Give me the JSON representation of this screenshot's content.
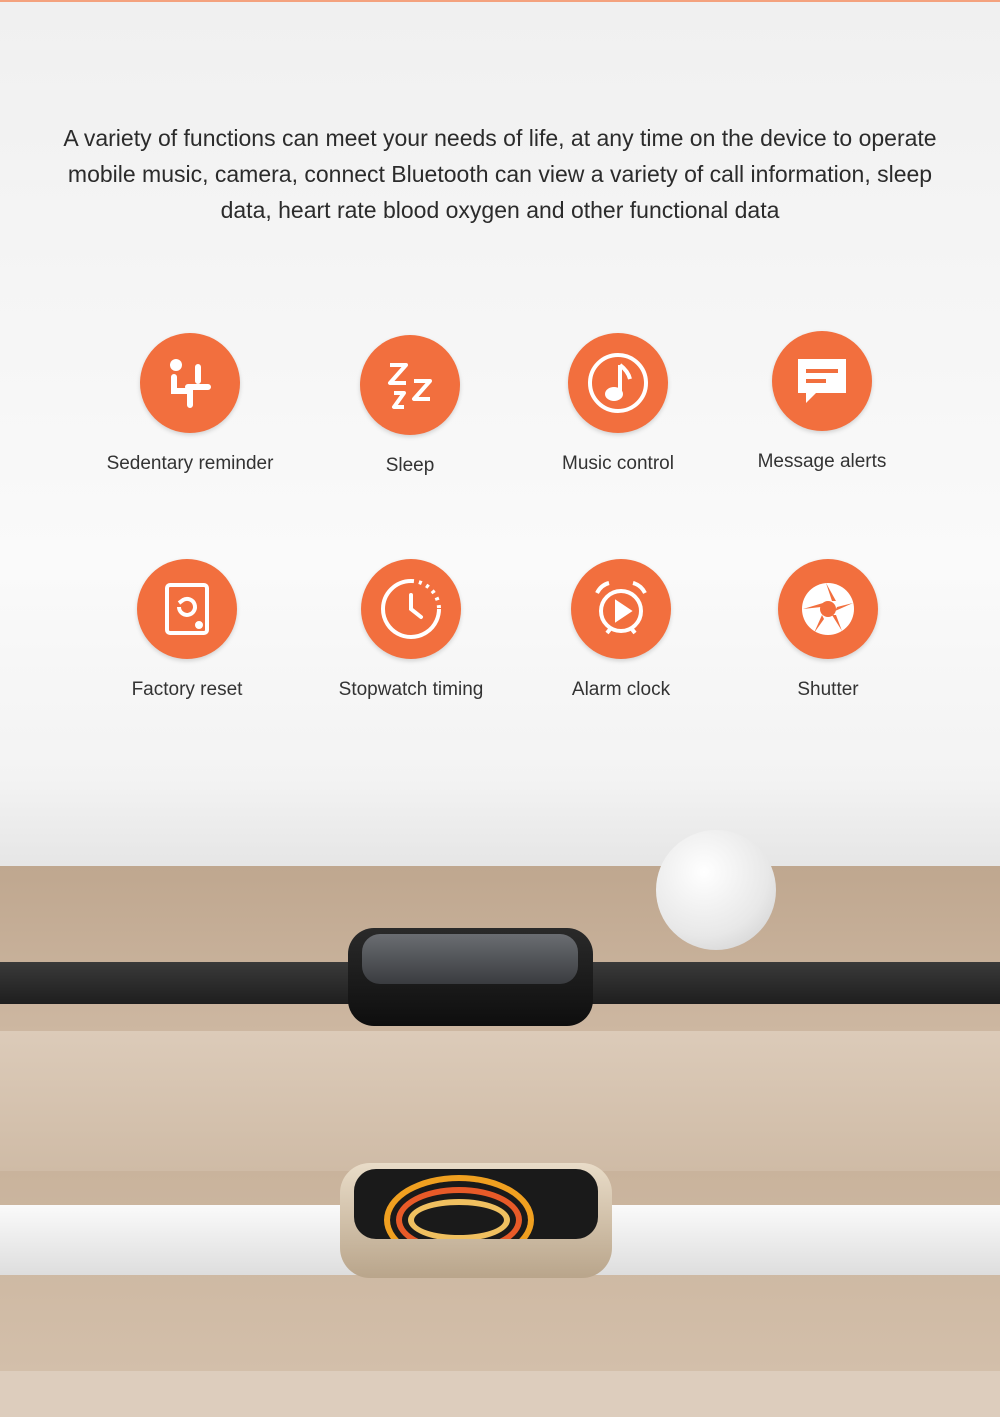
{
  "intro": "A variety of functions can meet your needs of life, at any time on the device to operate mobile music, camera, connect  Bluetooth can view a variety of call information, sleep data, heart rate blood oxygen and other functional data",
  "accent_color": "#f26f3e",
  "features": [
    {
      "label": "Sedentary reminder",
      "icon": "sedentary-icon"
    },
    {
      "label": "Sleep",
      "icon": "sleep-zzz-icon"
    },
    {
      "label": "Music control",
      "icon": "music-note-icon"
    },
    {
      "label": "Message alerts",
      "icon": "message-bubble-icon"
    },
    {
      "label": "Factory reset",
      "icon": "factory-reset-icon"
    },
    {
      "label": "Stopwatch timing",
      "icon": "stopwatch-icon"
    },
    {
      "label": "Alarm clock",
      "icon": "alarm-clock-icon"
    },
    {
      "label": "Shutter",
      "icon": "camera-shutter-icon"
    }
  ]
}
